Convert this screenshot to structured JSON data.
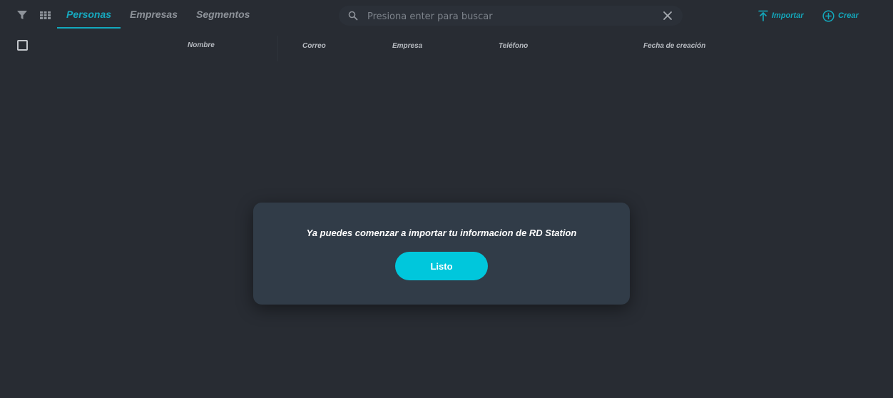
{
  "toolbar": {
    "icons": {
      "filter": "filter-icon",
      "grid": "grid-icon"
    },
    "tabs": [
      {
        "label": "Personas",
        "active": true
      },
      {
        "label": "Empresas",
        "active": false
      },
      {
        "label": "Segmentos",
        "active": false
      }
    ],
    "search": {
      "placeholder": "Presiona enter para buscar",
      "value": ""
    },
    "import_label": "Importar",
    "create_label": "Crear"
  },
  "table": {
    "columns": [
      "Nombre",
      "Correo",
      "Empresa",
      "Teléfono",
      "Fecha de creación"
    ]
  },
  "modal": {
    "message": "Ya puedes comenzar a importar tu informacion de RD Station",
    "button_label": "Listo"
  },
  "colors": {
    "background": "#282c33",
    "accent": "#13a9bd",
    "modal_background": "#313c48",
    "button": "#00c7dc"
  }
}
